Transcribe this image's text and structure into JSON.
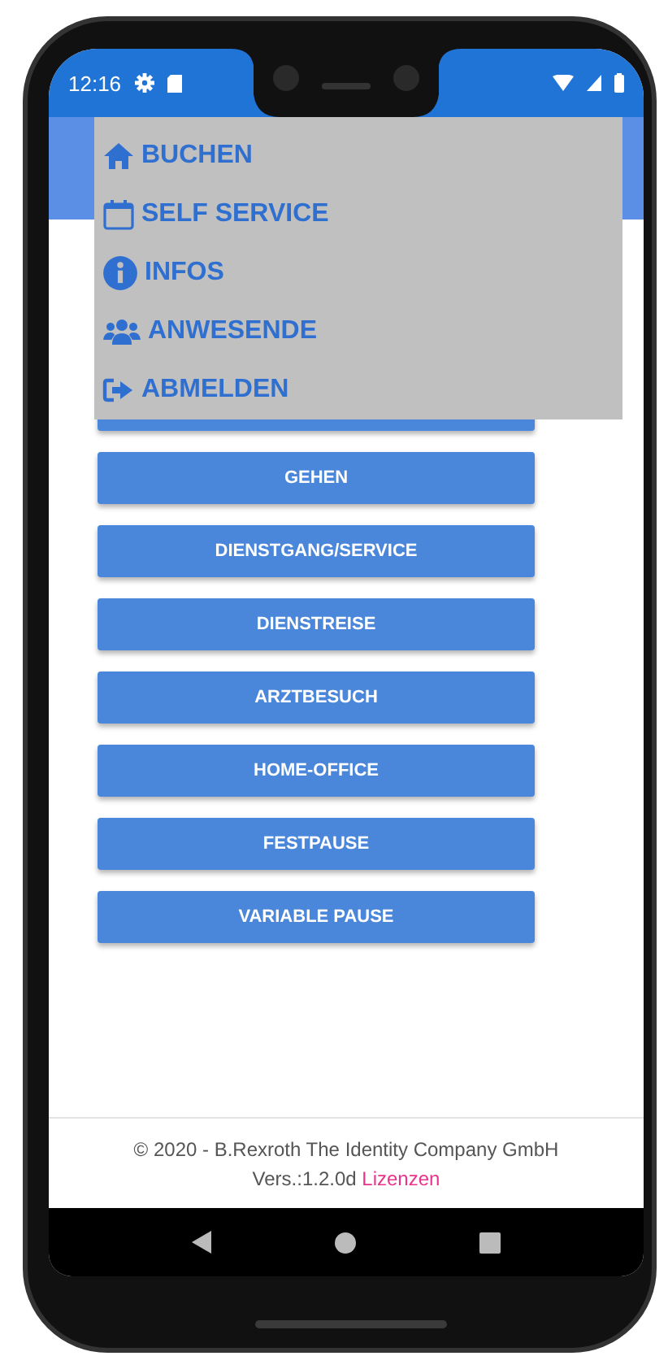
{
  "status_bar": {
    "time": "12:16"
  },
  "menu": [
    {
      "label": "BUCHEN",
      "kind": "home"
    },
    {
      "label": "SELF SERVICE",
      "kind": "calendar"
    },
    {
      "label": "INFOS",
      "kind": "info"
    },
    {
      "label": "ANWESENDE",
      "kind": "users"
    },
    {
      "label": "ABMELDEN",
      "kind": "logout"
    }
  ],
  "buttons": [
    {
      "kind": "covered"
    },
    {
      "label": "GEHEN",
      "kind": "action"
    },
    {
      "label": "DIENSTGANG/SERVICE",
      "kind": "action"
    },
    {
      "label": "DIENSTREISE",
      "kind": "action"
    },
    {
      "label": "ARZTBESUCH",
      "kind": "action"
    },
    {
      "label": "HOME-OFFICE",
      "kind": "action"
    },
    {
      "label": "FESTPAUSE",
      "kind": "action"
    },
    {
      "label": "VARIABLE PAUSE",
      "kind": "action"
    }
  ],
  "footer": {
    "copyright": "© 2020 - B.Rexroth The Identity Company GmbH",
    "version": "Vers.:1.2.0d",
    "link": "Lizenzen"
  }
}
